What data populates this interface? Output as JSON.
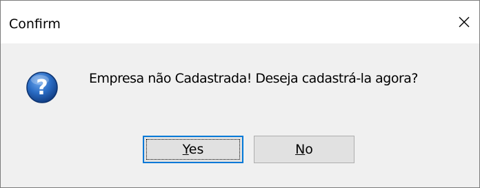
{
  "window": {
    "title": "Confirm",
    "close_glyph": "✕"
  },
  "message": {
    "text": "Empresa não Cadastrada! Deseja cadastrá-la agora?",
    "icon": "question-icon"
  },
  "buttons": {
    "yes": {
      "mnemonic": "Y",
      "rest": "es"
    },
    "no": {
      "mnemonic": "N",
      "rest": "o"
    }
  },
  "colors": {
    "accent": "#0078d7",
    "icon_blue": "#1e5fb4",
    "dialog_bg": "#f0f0f0"
  }
}
